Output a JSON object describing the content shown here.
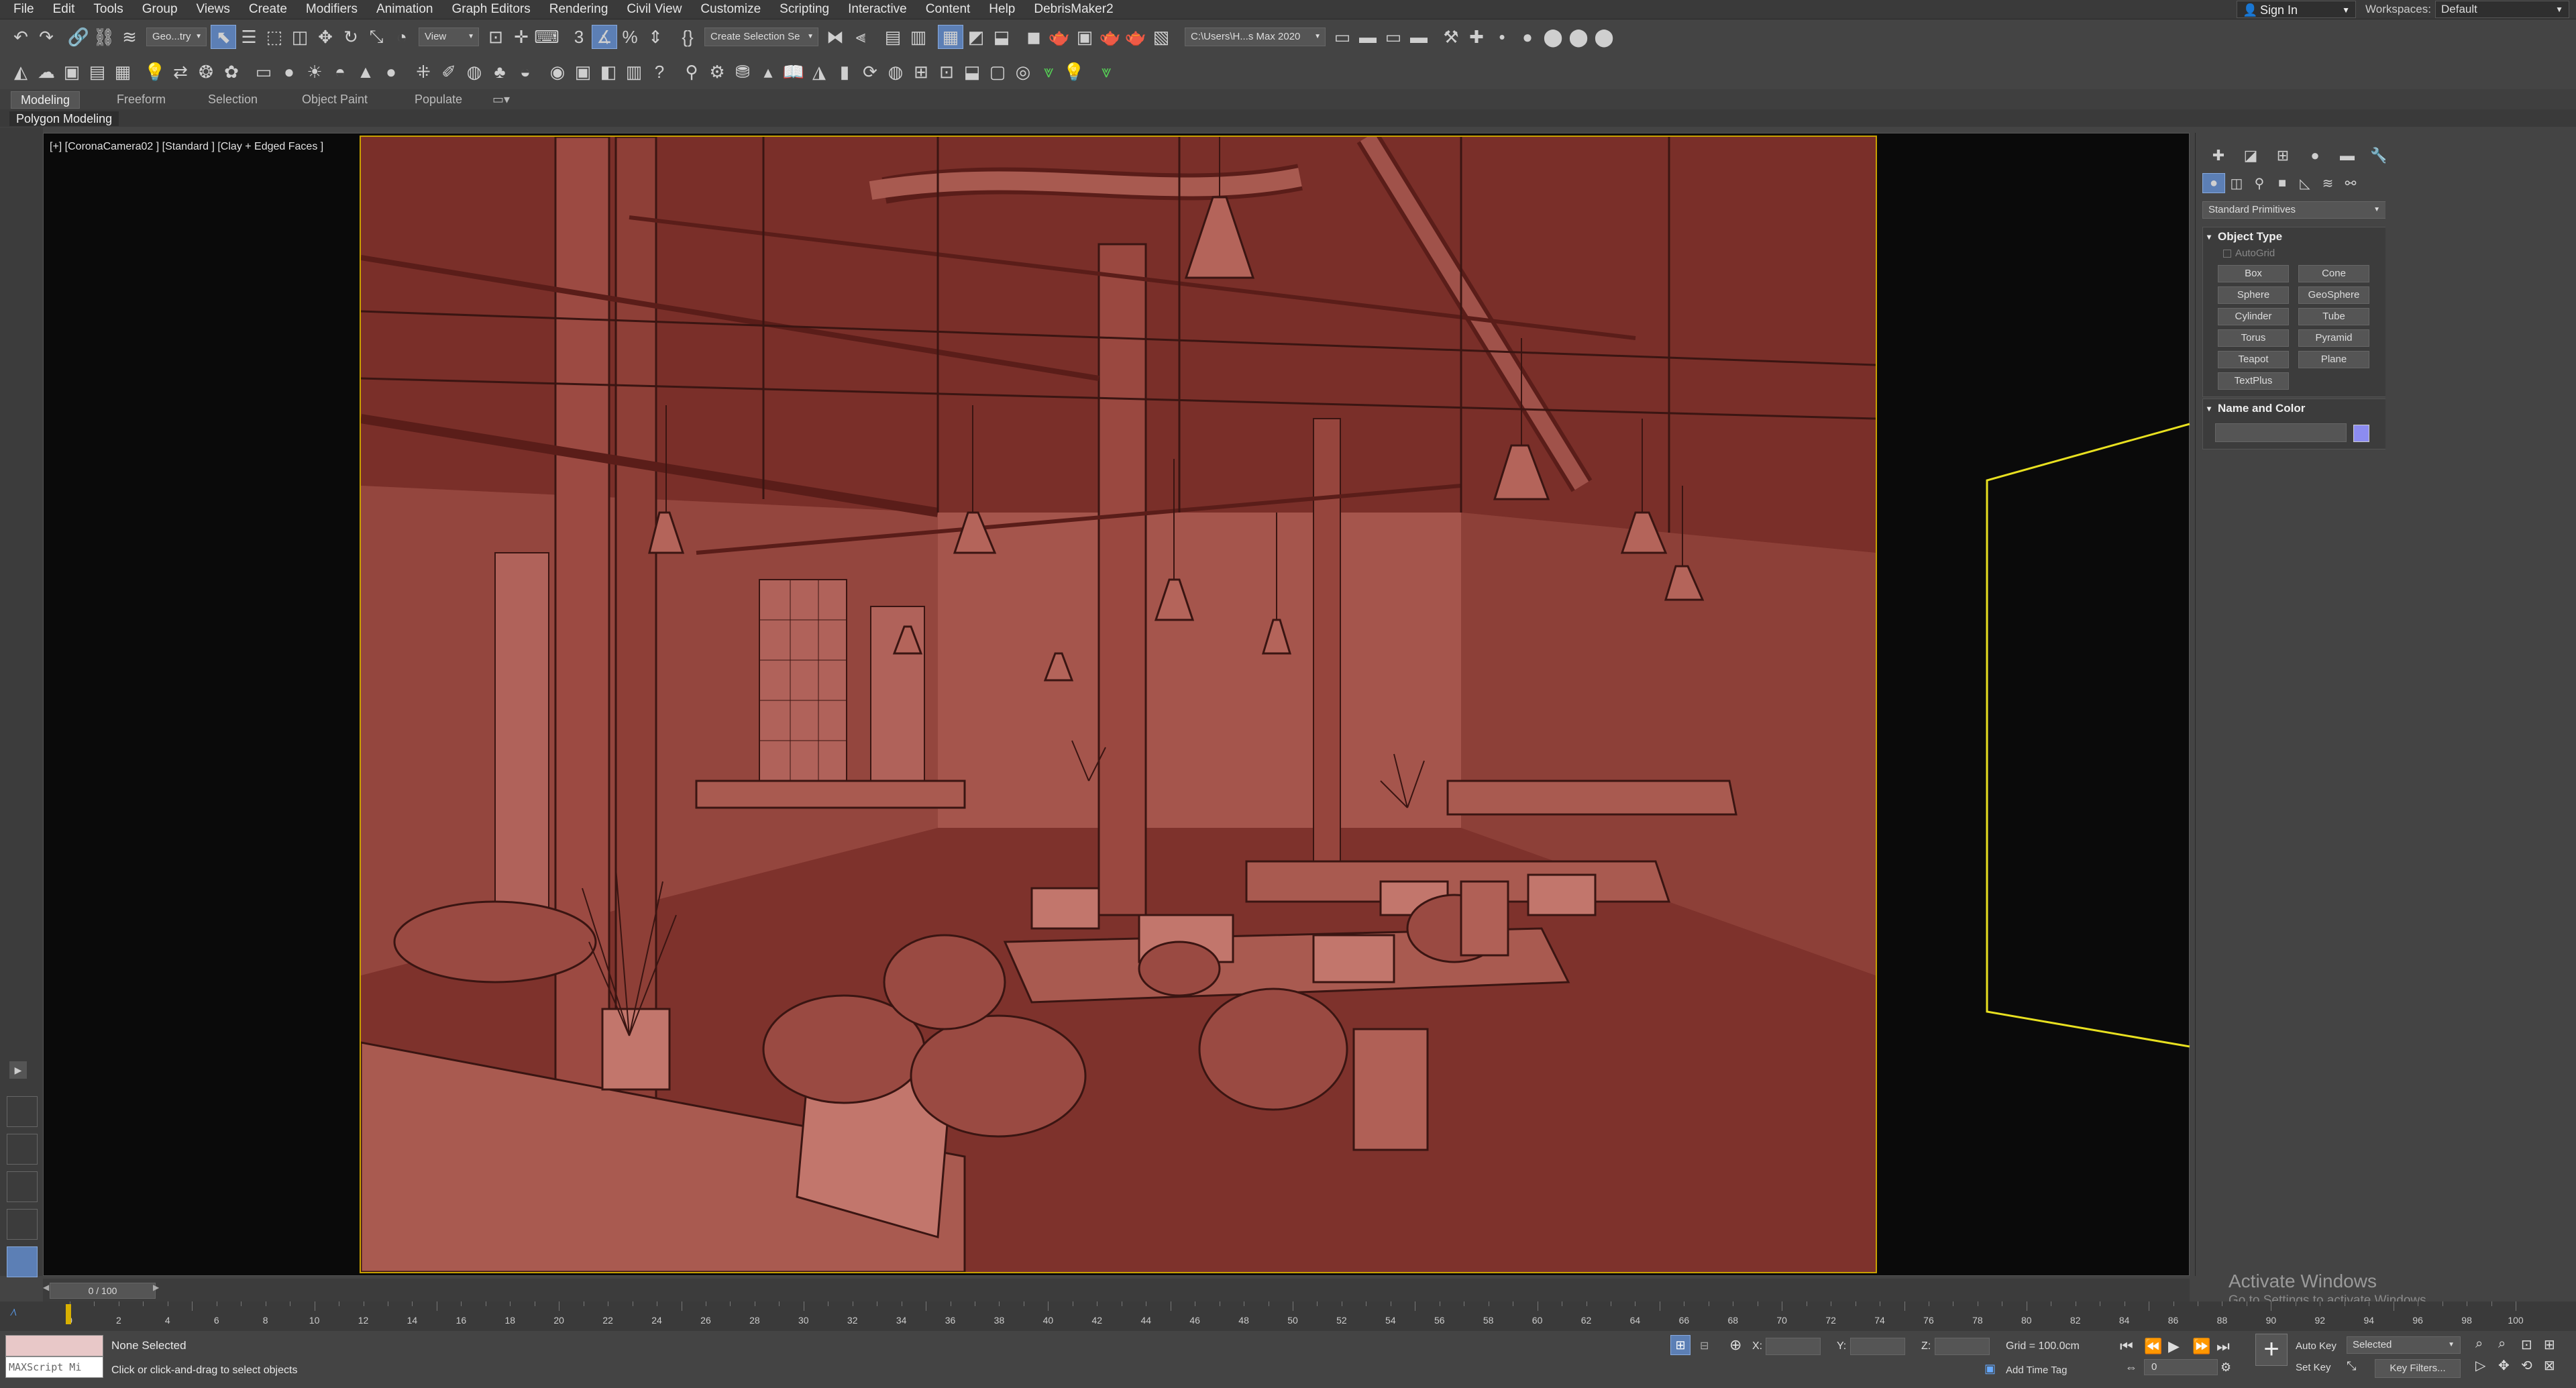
{
  "menubar": {
    "items": [
      "File",
      "Edit",
      "Tools",
      "Group",
      "Views",
      "Create",
      "Modifiers",
      "Animation",
      "Graph Editors",
      "Rendering",
      "Civil View",
      "Customize",
      "Scripting",
      "Interactive",
      "Content",
      "Help",
      "DebrisMaker2"
    ],
    "sign_in": "Sign In",
    "workspaces_label": "Workspaces:",
    "workspace_value": "Default"
  },
  "toolbar": {
    "selection_filter": "Geo...try",
    "ref_coord": "View",
    "selection_set": "Create Selection Se",
    "project_path": "C:\\Users\\H...s Max 2020"
  },
  "ribbon": {
    "tabs": [
      "Modeling",
      "Freeform",
      "Selection",
      "Object Paint",
      "Populate"
    ],
    "sub_label": "Polygon Modeling"
  },
  "viewport": {
    "label": "[+] [CoronaCamera02 ] [Standard ] [Clay + Edged Faces ]"
  },
  "command_panel": {
    "category_dropdown": "Standard Primitives",
    "object_type_title": "Object Type",
    "autogrid_label": "AutoGrid",
    "primitives": [
      "Box",
      "Cone",
      "Sphere",
      "GeoSphere",
      "Cylinder",
      "Tube",
      "Torus",
      "Pyramid",
      "Teapot",
      "Plane",
      "TextPlus"
    ],
    "name_color_title": "Name and Color",
    "object_color": "#8c8cf0"
  },
  "activation": {
    "title": "Activate Windows",
    "subtitle": "Go to Settings to activate Windows."
  },
  "timeline": {
    "frame_display": "0 / 100",
    "ticks": [
      "0",
      "2",
      "4",
      "6",
      "8",
      "10",
      "12",
      "14",
      "16",
      "18",
      "20",
      "22",
      "24",
      "26",
      "28",
      "30",
      "32",
      "34",
      "36",
      "38",
      "40",
      "42",
      "44",
      "46",
      "48",
      "50",
      "52",
      "54",
      "56",
      "58",
      "60",
      "62",
      "64",
      "66",
      "68",
      "70",
      "72",
      "74",
      "76",
      "78",
      "80",
      "82",
      "84",
      "86",
      "88",
      "90",
      "92",
      "94",
      "96",
      "98",
      "100"
    ]
  },
  "status": {
    "maxscript_label": "MAXScript Mi",
    "selection_status": "None Selected",
    "prompt": "Click or click-and-drag to select objects",
    "x_label": "X:",
    "y_label": "Y:",
    "z_label": "Z:",
    "grid": "Grid = 100.0cm",
    "add_time_tag": "Add Time Tag",
    "auto_key": "Auto Key",
    "set_key": "Set Key",
    "key_mode": "Selected",
    "key_filters": "Key Filters...",
    "current_frame": "0"
  }
}
